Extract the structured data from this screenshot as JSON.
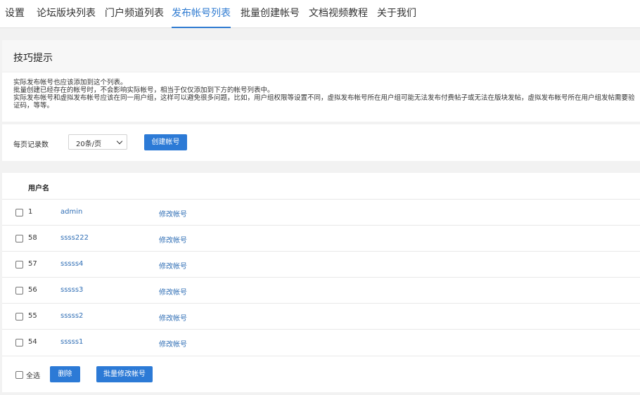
{
  "nav": {
    "tabs": [
      {
        "label": "设置"
      },
      {
        "label": "论坛版块列表"
      },
      {
        "label": "门户频道列表"
      },
      {
        "label": "发布帐号列表"
      },
      {
        "label": "批量创建帐号"
      },
      {
        "label": "文档视频教程"
      },
      {
        "label": "关于我们"
      }
    ],
    "active_index": 3
  },
  "tips": {
    "title": "技巧提示",
    "lines": [
      "实际发布帐号也应该添加到这个列表。",
      "批量创建已经存在的帐号时，不会影响实际帐号，相当于仅仅添加到下方的帐号列表中。",
      "实际发布帐号和虚拟发布帐号应该在同一用户组，这样可以避免很多问题，比如，用户组权限等设置不同，虚拟发布帐号所在用户组可能无法发布付费帖子或无法在版块发帖，虚拟发布帐号所在用户组发帖需要验证码，等等。"
    ]
  },
  "controls": {
    "per_page_label": "每页记录数",
    "per_page_value": "20条/页",
    "create_button": "创建帐号"
  },
  "list": {
    "column_header": "用户名",
    "edit_label": "修改帐号",
    "rows": [
      {
        "id": "1",
        "username": "admin"
      },
      {
        "id": "58",
        "username": "ssss222"
      },
      {
        "id": "57",
        "username": "sssss4"
      },
      {
        "id": "56",
        "username": "sssss3"
      },
      {
        "id": "55",
        "username": "sssss2"
      },
      {
        "id": "54",
        "username": "sssss1"
      }
    ]
  },
  "footer": {
    "select_all": "全选",
    "delete_button": "删除",
    "batch_edit_button": "批量修改帐号"
  },
  "colors": {
    "accent": "#2c7ad6",
    "link": "#2f6eb5"
  }
}
